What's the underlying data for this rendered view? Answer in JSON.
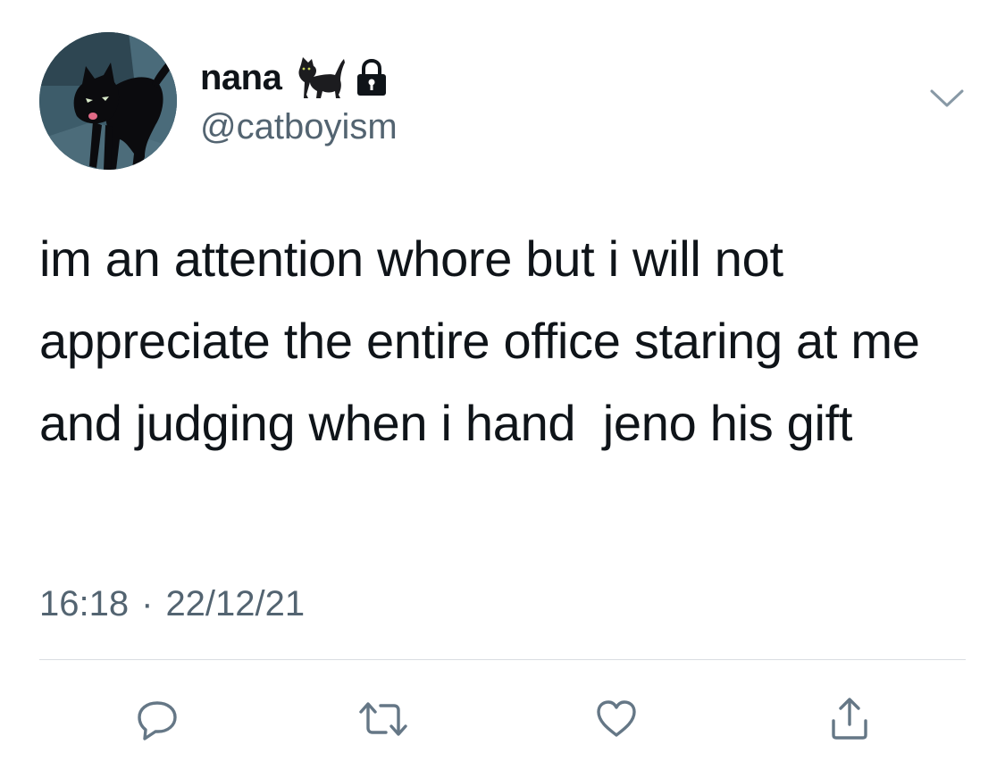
{
  "user": {
    "display_name": "nana",
    "handle": "@catboyism",
    "name_emoji": "cat-emoji",
    "protected_icon": "lock-icon",
    "avatar": "black-cat-avatar"
  },
  "tweet": {
    "text": "im an attention whore but i will not appreciate the entire office staring at me and judging when i hand  jeno his gift",
    "time": "16:18",
    "separator": "·",
    "date": "22/12/21"
  },
  "menu": {
    "icon": "chevron-down-icon"
  },
  "actions": [
    {
      "name": "reply",
      "icon": "reply-icon"
    },
    {
      "name": "retweet",
      "icon": "retweet-icon"
    },
    {
      "name": "like",
      "icon": "heart-icon"
    },
    {
      "name": "share",
      "icon": "share-icon"
    }
  ],
  "colors": {
    "text_primary": "#0f1419",
    "text_secondary": "#536471",
    "icon": "#657786",
    "divider": "#d9dde1",
    "background": "#ffffff"
  }
}
